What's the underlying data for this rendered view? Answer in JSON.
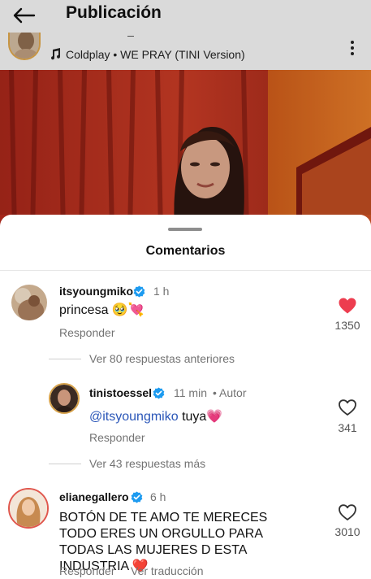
{
  "header": {
    "title": "Publicación",
    "back_icon": "arrow-left-icon"
  },
  "post": {
    "music_icon": "music-note-icon",
    "music_text": "Coldplay • WE PRAY (TINI Version)",
    "more_icon": "more-vertical-icon"
  },
  "sheet": {
    "title": "Comentarios"
  },
  "comments": [
    {
      "username": "itsyoungmiko",
      "verified": true,
      "time": "1 h",
      "text": "princesa 🥹💘",
      "reply_label": "Responder",
      "liked": true,
      "likes": "1350"
    },
    {
      "username": "tinistoessel",
      "verified": true,
      "time": "11 min",
      "author_tag": "• Autor",
      "mention": "@itsyoungmiko",
      "text": " tuya💗",
      "reply_label": "Responder",
      "liked": false,
      "likes": "341"
    },
    {
      "username": "elianegallero",
      "verified": true,
      "time": "6 h",
      "text": "BOTÓN DE TE AMO TE MERECES TODO ERES UN ORGULLO PARA TODAS LAS MUJERES D ESTA INDUSTRIA ❤️",
      "reply_label": "Responder",
      "translate_label": "Ver traducción",
      "liked": false,
      "likes": "3010"
    }
  ],
  "threads": {
    "previous_replies": "Ver 80 respuestas anteriores",
    "more_replies": "Ver 43 respuestas más"
  },
  "colors": {
    "like_red": "#ed3d4f",
    "verified_blue": "#1d9bf0",
    "mention_blue": "#2a56b8",
    "muted_text": "#737373"
  }
}
